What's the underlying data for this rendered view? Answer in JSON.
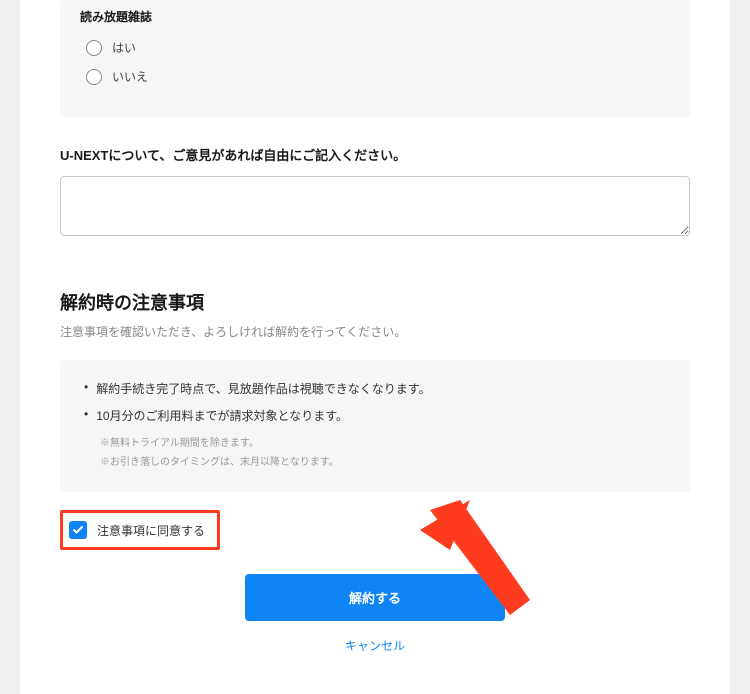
{
  "survey": {
    "question": "読み放題雑誌",
    "options": [
      "はい",
      "いいえ"
    ]
  },
  "feedback": {
    "label": "U-NEXTについて、ご意見があれば自由にご記入ください。",
    "value": ""
  },
  "cancellation": {
    "title": "解約時の注意事項",
    "description": "注意事項を確認いただき、よろしければ解約を行ってください。",
    "notices": [
      "解約手続き完了時点で、見放題作品は視聴できなくなります。",
      "10月分のご利用料までが請求対象となります。"
    ],
    "subnotes": [
      "※無料トライアル期間を除きます。",
      "※お引き落しのタイミングは、末月以降となります。"
    ],
    "consent_label": "注意事項に同意する"
  },
  "buttons": {
    "submit": "解約する",
    "cancel": "キャンセル"
  },
  "colors": {
    "accent": "#0f84f5",
    "highlight_border": "#ff3b1f"
  }
}
